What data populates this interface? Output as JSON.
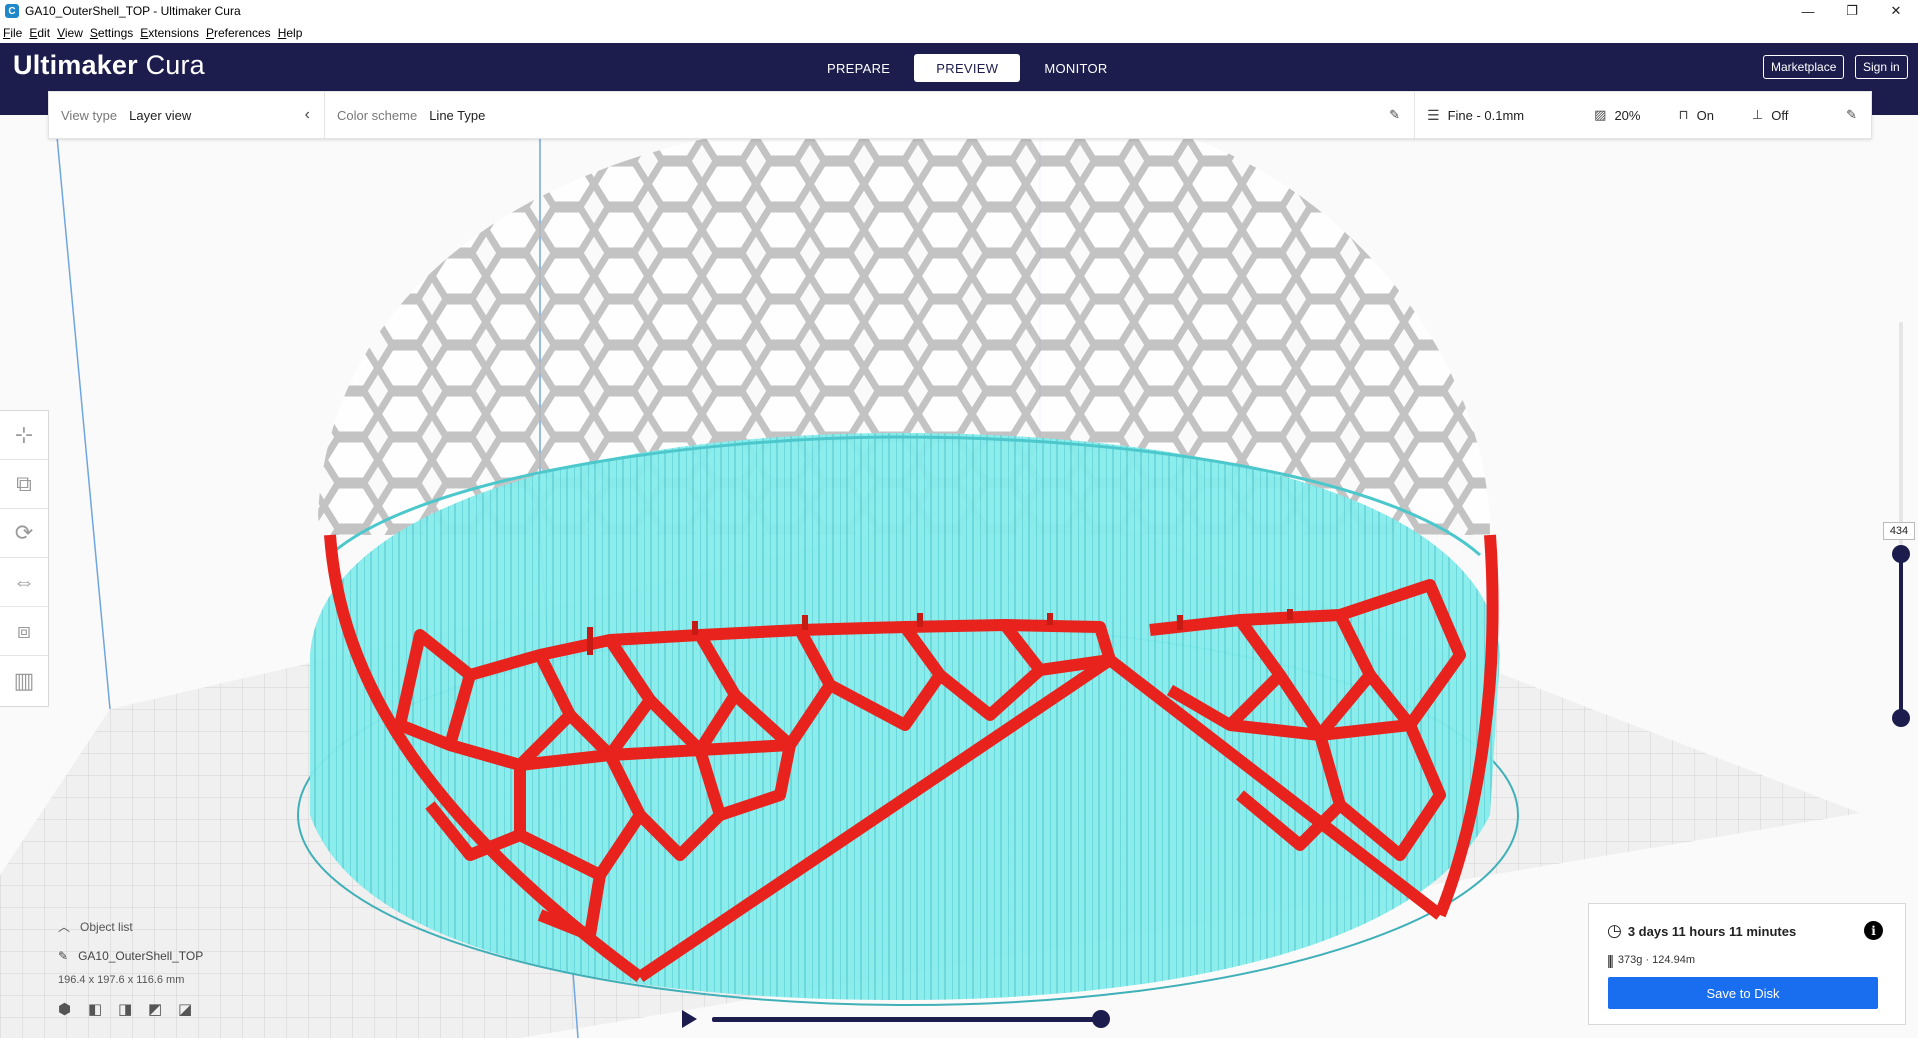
{
  "window": {
    "title": "GA10_OuterShell_TOP - Ultimaker Cura",
    "icon_text": "C",
    "minimize": "—",
    "restore": "❐",
    "close": "✕"
  },
  "menu": [
    "File",
    "Edit",
    "View",
    "Settings",
    "Extensions",
    "Preferences",
    "Help"
  ],
  "header": {
    "logo_bold": "Ultimaker",
    "logo_light": "Cura",
    "tabs": [
      {
        "label": "PREPARE"
      },
      {
        "label": "PREVIEW"
      },
      {
        "label": "MONITOR"
      }
    ],
    "active_tab": "PREVIEW",
    "marketplace": "Marketplace",
    "signin": "Sign in"
  },
  "toolbar": {
    "view_type_label": "View type",
    "view_type_value": "Layer view",
    "color_scheme_label": "Color scheme",
    "color_scheme_value": "Line Type",
    "profile": "Fine - 0.1mm",
    "infill": "20%",
    "support": "On",
    "adhesion": "Off"
  },
  "tools": [
    "move-tool",
    "scale-tool",
    "rotate-tool",
    "mirror-tool",
    "per-model-settings-tool",
    "support-blocker-tool"
  ],
  "layer": {
    "current": "434",
    "min_fraction": 0.0,
    "max_fraction": 1.0
  },
  "object_list": {
    "header": "Object list",
    "name": "GA10_OuterShell_TOP",
    "dimensions": "196.4 x 197.6 x 116.6 mm"
  },
  "playback": {
    "progress": 1.0
  },
  "print_info": {
    "time": "3 days 11 hours 11 minutes",
    "material": "373g · 124.94m",
    "info_icon": "i",
    "save_button": "Save to Disk"
  },
  "colors": {
    "header_bg": "#1c1d4d",
    "accent": "#196ef0",
    "shell_red": "#e8231d",
    "infill_cyan": "#7fe6e6",
    "ghost_gray": "#c8c8c8"
  }
}
